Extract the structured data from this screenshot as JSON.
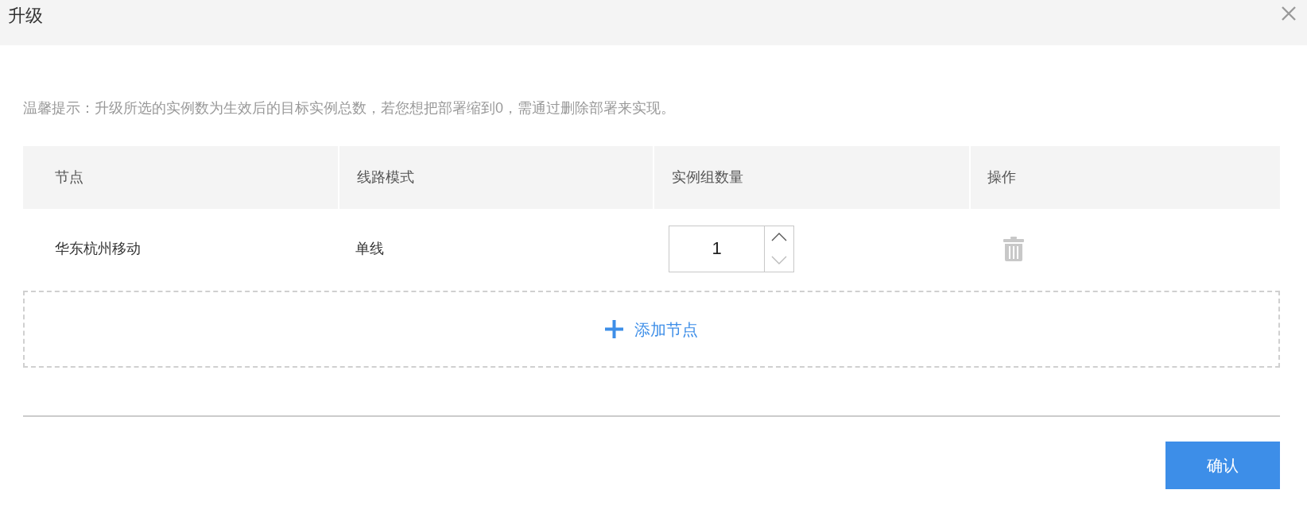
{
  "dialog": {
    "title": "升级",
    "tip": "温馨提示：升级所选的实例数为生效后的目标实例总数，若您想把部署缩到0，需通过删除部署来实现。",
    "table": {
      "columns": [
        "节点",
        "线路模式",
        "实例组数量",
        "操作"
      ],
      "rows": [
        {
          "node": "华东杭州移动",
          "line_mode": "单线",
          "instance_count": "1",
          "decrement_disabled": true
        }
      ]
    },
    "add_button": "添加节点",
    "confirm_button": "确认"
  }
}
